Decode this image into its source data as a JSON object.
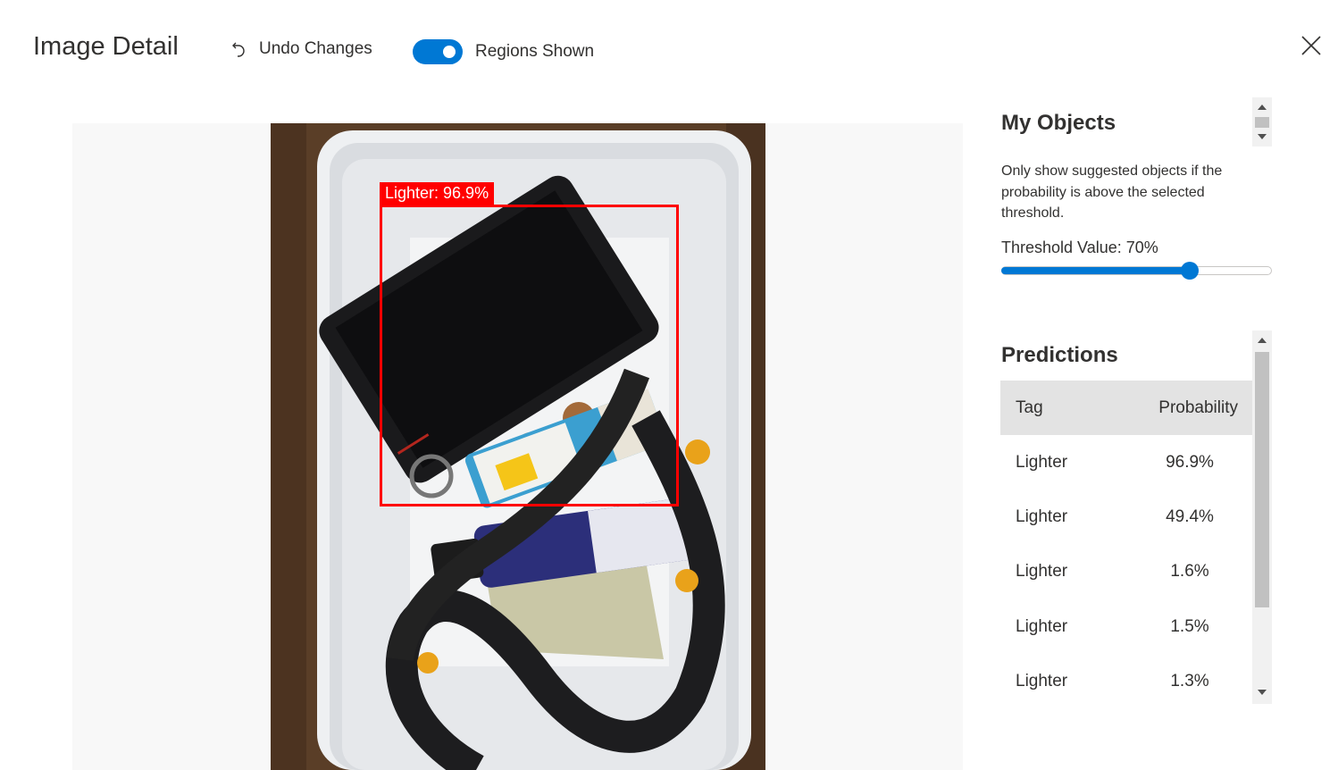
{
  "header": {
    "title": "Image Detail",
    "undo_label": "Undo Changes",
    "regions_label": "Regions Shown",
    "regions_on": true
  },
  "region": {
    "label": "Lighter: 96.9%",
    "color": "#ff0000"
  },
  "panel": {
    "objects_title": "My Objects",
    "help_text": "Only show suggested objects if the probability is above the selected threshold.",
    "threshold_label": "Threshold Value: 70%",
    "threshold_value": 0.7,
    "predictions_title": "Predictions",
    "table": {
      "headers": [
        "Tag",
        "Probability"
      ],
      "rows": [
        {
          "tag": "Lighter",
          "probability": "96.9%"
        },
        {
          "tag": "Lighter",
          "probability": "49.4%"
        },
        {
          "tag": "Lighter",
          "probability": "1.6%"
        },
        {
          "tag": "Lighter",
          "probability": "1.5%"
        },
        {
          "tag": "Lighter",
          "probability": "1.3%"
        }
      ]
    }
  },
  "colors": {
    "accent": "#0078d4",
    "region": "#ff0000"
  },
  "icons": [
    "undo-icon",
    "close-icon",
    "scroll-up-icon",
    "scroll-down-icon"
  ]
}
